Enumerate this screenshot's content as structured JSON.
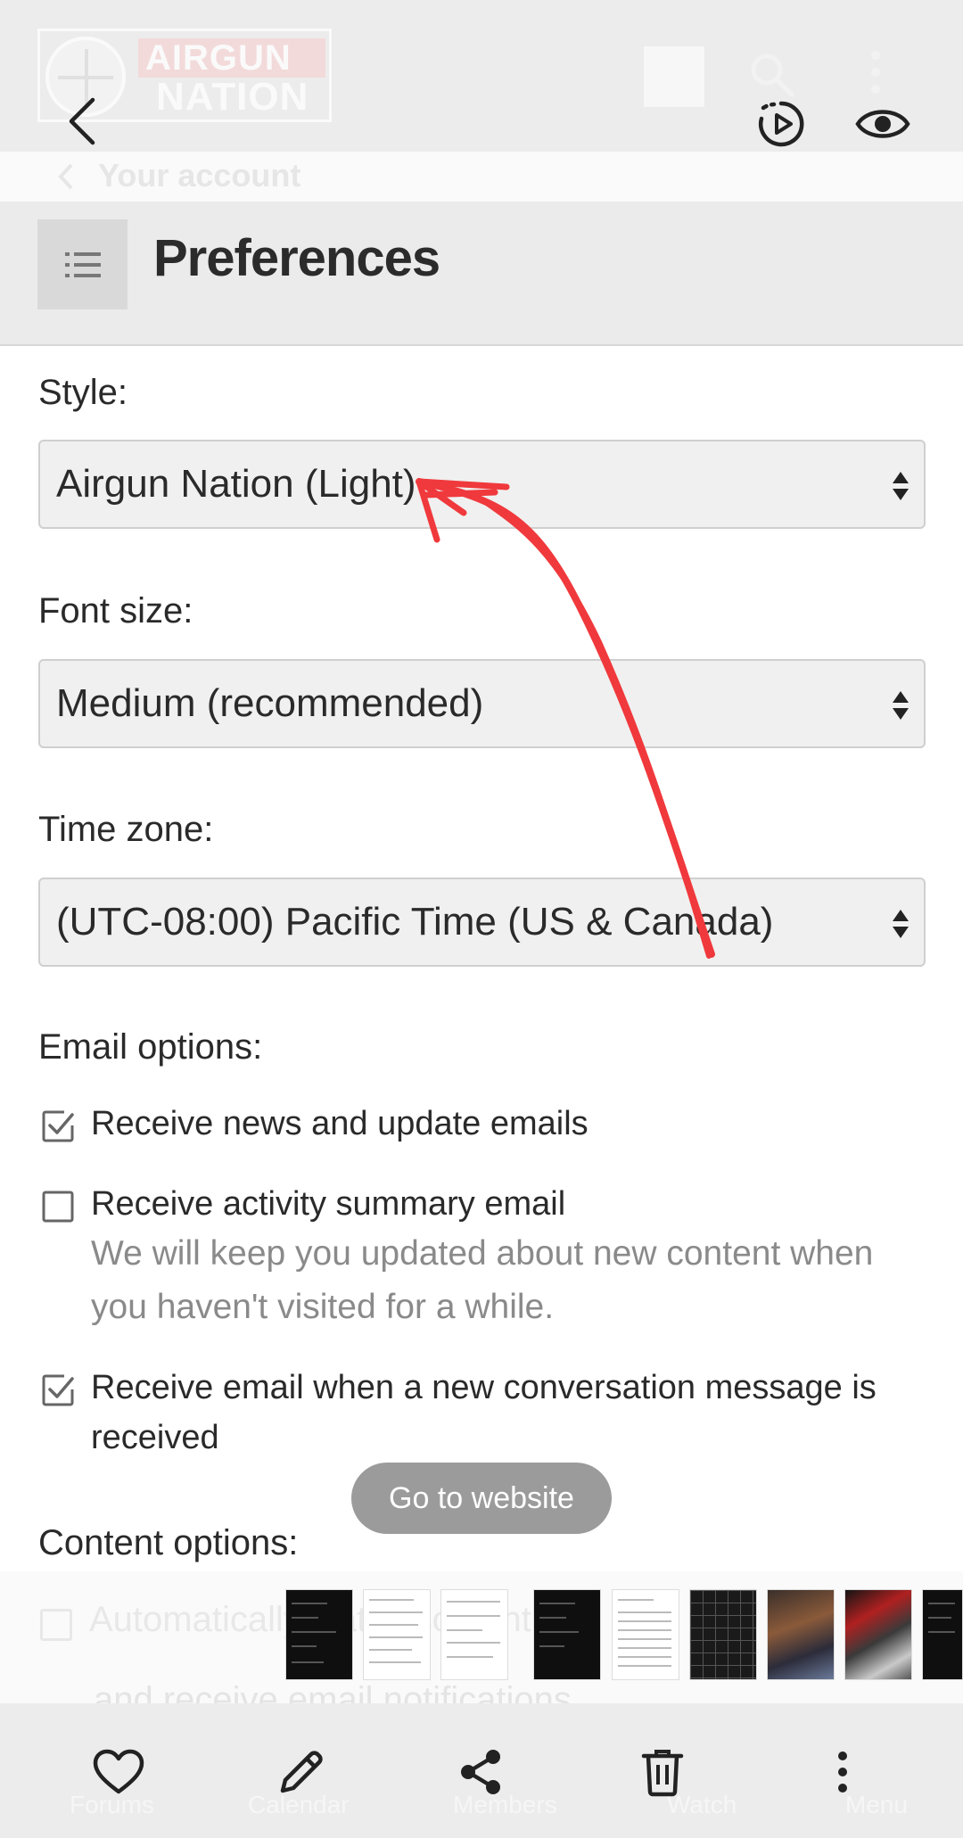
{
  "site": {
    "logo_top": "AIRGUN",
    "logo_bottom": "NATION"
  },
  "breadcrumb": {
    "label": "Your account"
  },
  "page": {
    "title": "Preferences"
  },
  "form": {
    "style": {
      "label": "Style:",
      "value": "Airgun Nation (Light)"
    },
    "font_size": {
      "label": "Font size:",
      "value": "Medium (recommended)"
    },
    "time_zone": {
      "label": "Time zone:",
      "value": "(UTC-08:00) Pacific Time (US & Canada)"
    },
    "email_options": {
      "label": "Email options:",
      "items": [
        {
          "label": "Receive news and update emails",
          "checked": true
        },
        {
          "label": "Receive activity summary email",
          "checked": false,
          "hint": "We will keep you updated about new content when you haven't visited for a while."
        },
        {
          "label": "Receive email when a new conversation message is received",
          "checked": true
        }
      ]
    },
    "content_options": {
      "label": "Content options:",
      "faded_item": "Automatically watch content",
      "faded_subitem": "and receive email notifications"
    }
  },
  "overlay": {
    "go_to_website": "Go to website"
  },
  "bottom_nav_faded": [
    "Forums",
    "Calendar",
    "Members",
    "Watch",
    "Menu"
  ],
  "icons": {
    "back": "back-arrow-icon",
    "motion_photo": "motion-photo-icon",
    "eye": "eye-icon",
    "menu": "list-menu-icon",
    "favorite": "heart-icon",
    "edit": "pencil-icon",
    "share": "share-icon",
    "delete": "trash-icon",
    "more": "more-vertical-icon"
  },
  "colors": {
    "annotation": "#f0393c",
    "overlay_bar": "#ececec",
    "select_bg": "#f0f0f0"
  }
}
